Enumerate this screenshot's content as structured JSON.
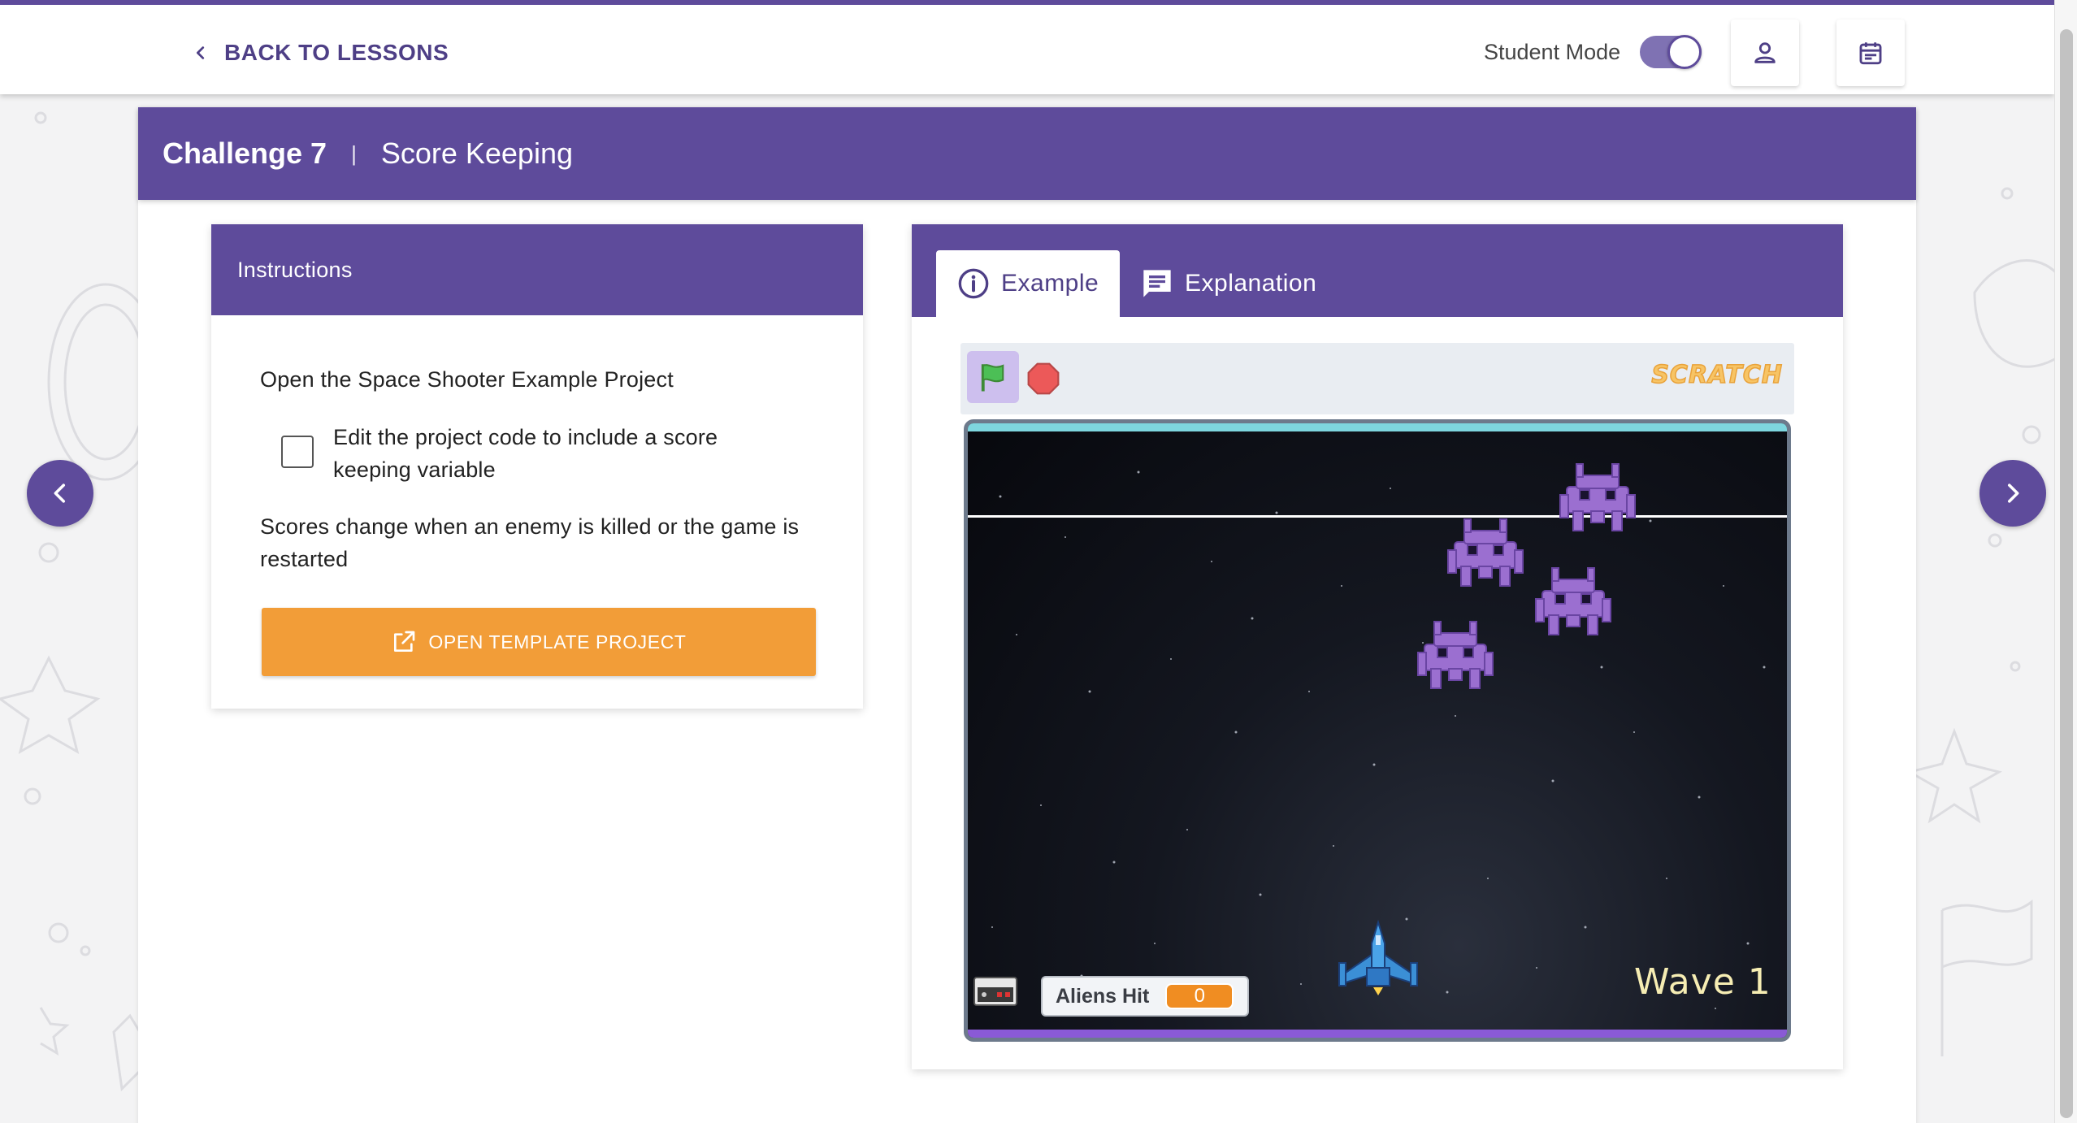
{
  "topbar": {
    "back_label": "BACK TO LESSONS",
    "student_mode_label": "Student Mode",
    "student_mode_on": true
  },
  "challenge": {
    "number": "Challenge 7",
    "separator": "|",
    "name": "Score Keeping"
  },
  "instructions": {
    "header": "Instructions",
    "line1": "Open the Space Shooter Example Project",
    "task": "Edit the project code to include a score keeping variable",
    "task_checked": false,
    "line3": "Scores change when an enemy is killed or the game is restarted",
    "open_button_label": "OPEN TEMPLATE PROJECT"
  },
  "example_panel": {
    "tabs": [
      {
        "label": "Example",
        "icon": "info-icon",
        "active": true
      },
      {
        "label": "Explanation",
        "icon": "comment-icon",
        "active": false
      }
    ],
    "scratch_logo": "SCRATCH",
    "game": {
      "score_label": "Aliens Hit",
      "score_value": "0",
      "wave_label": "Wave 1"
    }
  },
  "colors": {
    "brand": "#5e4b9b",
    "accent_orange": "#f29d38",
    "alien": "#9b6fd0"
  }
}
